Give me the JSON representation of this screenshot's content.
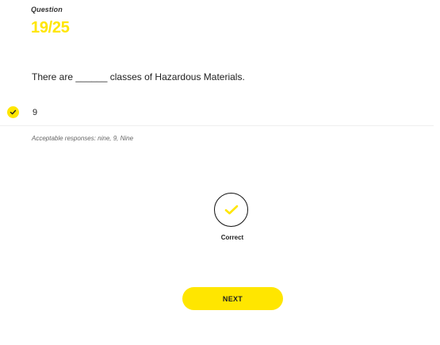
{
  "header": {
    "label": "Question",
    "counter": "19/25"
  },
  "question": {
    "text": "There are ______ classes of Hazardous Materials."
  },
  "answer": {
    "value": "9",
    "icon": "check-icon",
    "acceptable": "Acceptable responses: nine, 9, Nine"
  },
  "result": {
    "icon": "check-icon",
    "label": "Correct"
  },
  "actions": {
    "next_label": "NEXT"
  },
  "colors": {
    "accent": "#ffe600",
    "text": "#222222",
    "muted": "#666666"
  }
}
